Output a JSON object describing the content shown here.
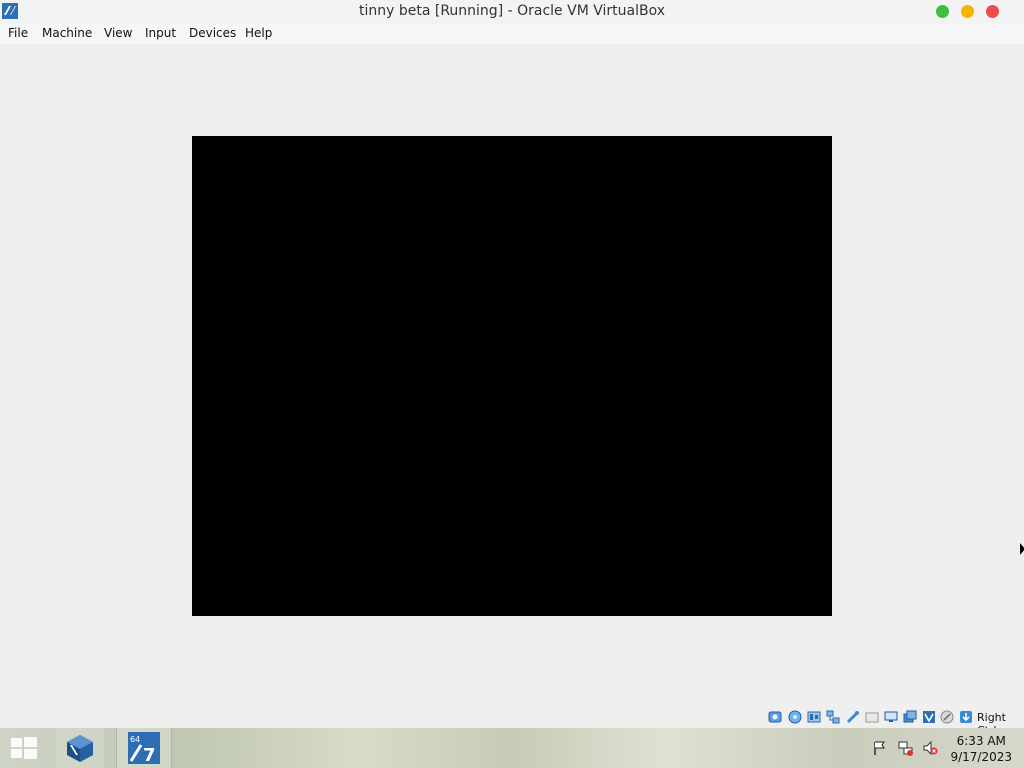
{
  "window": {
    "title": "tinny beta [Running] - Oracle VM VirtualBox",
    "controls": {
      "minimize_color": "#3fbf3f",
      "maximize_color": "#f4b400",
      "close_color": "#ef4b4b"
    }
  },
  "menu": {
    "items": [
      "File",
      "Machine",
      "View",
      "Input",
      "Devices",
      "Help"
    ]
  },
  "vm": {
    "screen_color": "#000000"
  },
  "statusbar": {
    "icons": [
      "hard-disk-icon",
      "optical-drive-icon",
      "audio-icon",
      "network-icon",
      "usb-icon",
      "shared-folders-icon",
      "display-icon",
      "video-capture-icon",
      "virtualization-icon",
      "mouse-integration-icon",
      "keyboard-capture-icon"
    ],
    "host_key": "Right Ctrl"
  },
  "taskbar": {
    "pinned": [
      "start-button",
      "virtualbox-taskbar-button",
      "seven-zip-taskbar-button"
    ],
    "tray_icons": [
      "action-center-flag-icon",
      "network-icon",
      "volume-muted-icon"
    ],
    "time": "6:33 AM",
    "date": "9/17/2023"
  }
}
